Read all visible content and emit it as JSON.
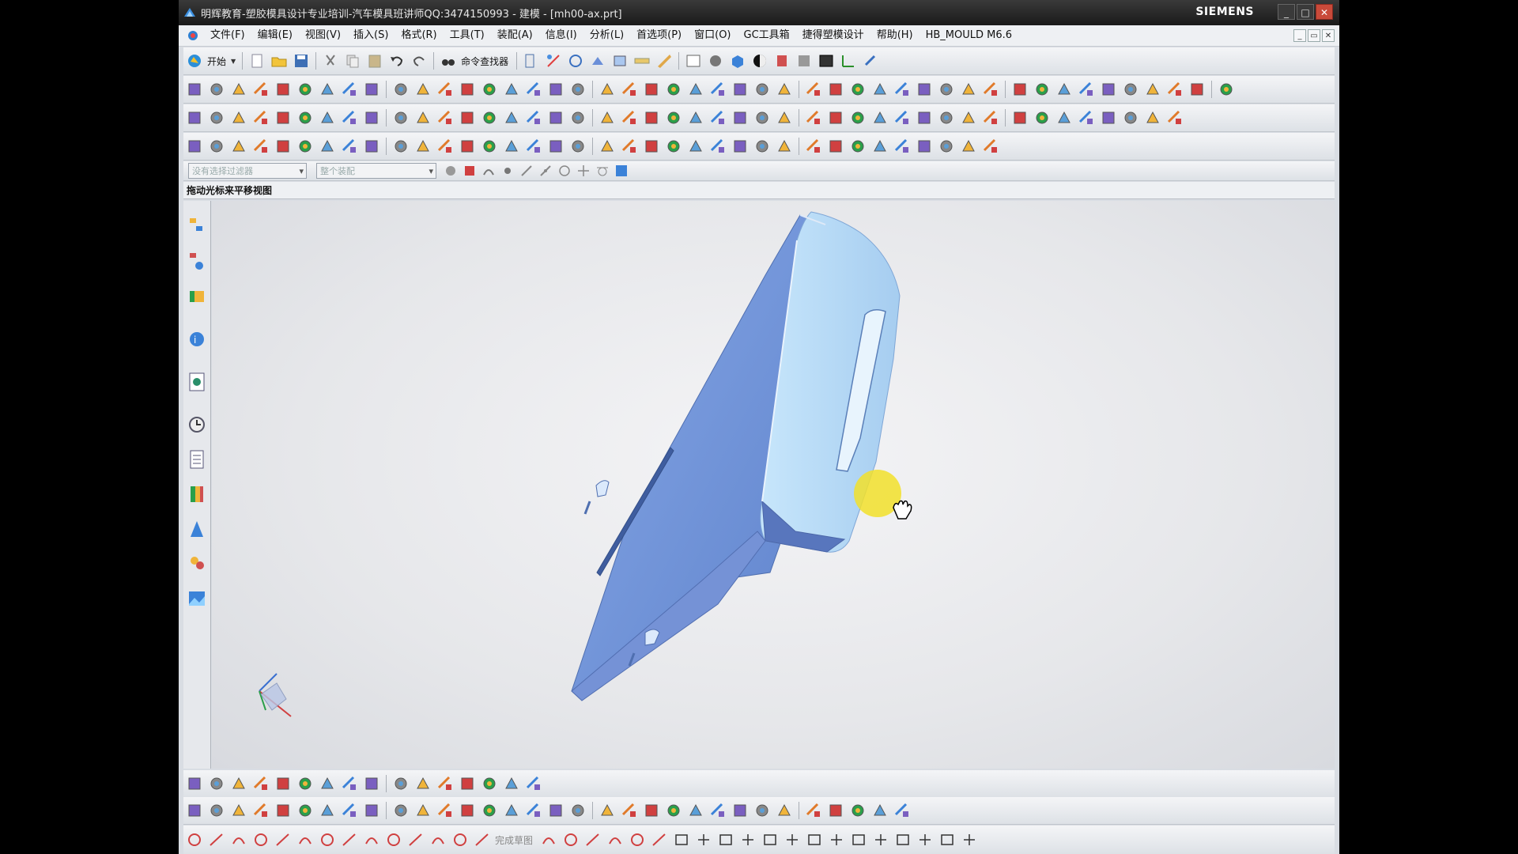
{
  "window": {
    "title": "明辉教育-塑胶模具设计专业培训-汽车模具班讲师QQ:3474150993 - 建模 - [mh00-ax.prt]",
    "brand": "SIEMENS",
    "controls": [
      "_",
      "□",
      "✕"
    ]
  },
  "menu": {
    "items": [
      "文件(F)",
      "编辑(E)",
      "视图(V)",
      "插入(S)",
      "格式(R)",
      "工具(T)",
      "装配(A)",
      "信息(I)",
      "分析(L)",
      "首选项(P)",
      "窗口(O)",
      "GC工具箱",
      "捷得塑模设计",
      "帮助(H)",
      "HB_MOULD M6.6"
    ],
    "mdi_controls": [
      "_",
      "▭",
      "✕"
    ]
  },
  "toolbar": {
    "start_label": "开始",
    "command_finder_label": "命令查找器"
  },
  "selection_bar": {
    "filter_placeholder": "没有选择过滤器",
    "scope_placeholder": "整个装配"
  },
  "cue_line": "拖动光标来平移视图",
  "sketch_toolbar": {
    "finish_sketch_label": "完成草图"
  },
  "colors": {
    "part_dark": "#6f93d8",
    "part_light": "#b7dbf6",
    "cursor_highlight": "#f2e02a",
    "background": "#e6e7ea"
  },
  "icons": {
    "toolbar_row1": [
      "new-icon",
      "open-icon",
      "save-icon",
      "cut-icon",
      "copy-icon",
      "paste-icon",
      "undo-icon",
      "redo-icon"
    ],
    "viewport": [
      "triad-icon",
      "pan-cursor-icon"
    ]
  }
}
